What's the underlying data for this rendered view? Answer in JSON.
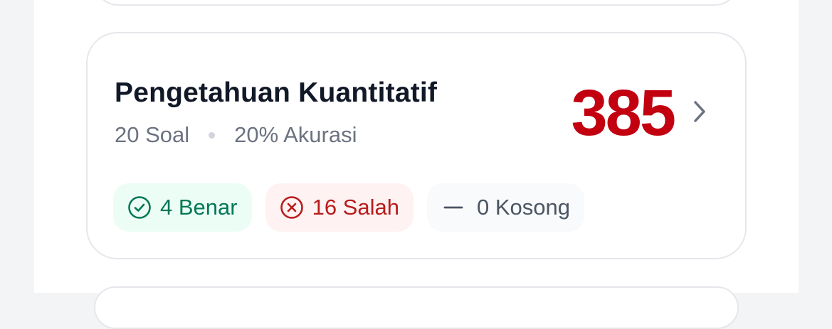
{
  "result_card": {
    "title": "Pengetahuan Kuantitatif",
    "questions": "20 Soal",
    "accuracy": "20% Akurasi",
    "score": "385",
    "badges": {
      "correct": "4 Benar",
      "wrong": "16 Salah",
      "empty": "0 Kosong"
    },
    "icons": {
      "correct": "check-circle-icon",
      "wrong": "x-circle-icon",
      "empty": "dash-icon",
      "more": "chevron-right-icon"
    }
  },
  "colors": {
    "score": "#c2000f",
    "correct": "#047857",
    "wrong": "#b91c1c",
    "empty": "#4b5563"
  }
}
